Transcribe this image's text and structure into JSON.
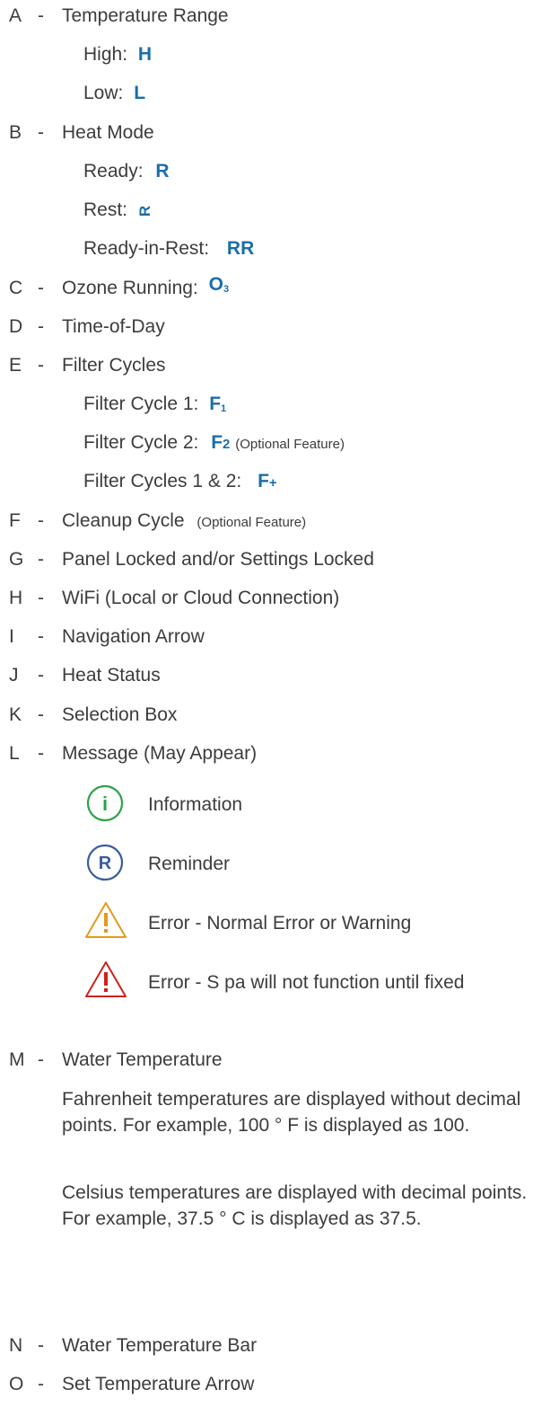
{
  "items": {
    "A": {
      "letter": "A",
      "dash": "-",
      "label": "Temperature Range"
    },
    "A_sub": [
      {
        "text": "High:",
        "sym": "H"
      },
      {
        "text": "Low:",
        "sym": "L"
      }
    ],
    "B": {
      "letter": "B",
      "dash": "-",
      "label": "Heat Mode"
    },
    "B_sub": [
      {
        "text": "Ready:",
        "sym": "R"
      },
      {
        "text": "Rest:",
        "sym": "R"
      },
      {
        "text": "Ready-in-Rest:",
        "sym": "RR"
      }
    ],
    "C": {
      "letter": "C",
      "dash": "-",
      "label": "Ozone Running:",
      "sym": "O",
      "sym_sub": "3"
    },
    "D": {
      "letter": "D",
      "dash": "-",
      "label": "Time-of-Day"
    },
    "E": {
      "letter": "E",
      "dash": "-",
      "label": "Filter Cycles"
    },
    "E_sub": [
      {
        "text": "Filter Cycle 1:",
        "sym": "F",
        "sym_sub": "1",
        "note": ""
      },
      {
        "text": "Filter Cycle 2:",
        "sym": "F",
        "sym_sub": "2",
        "note": "(Optional Feature)"
      },
      {
        "text": "Filter Cycles 1 & 2:",
        "sym": "F",
        "sym_sub": "+",
        "note": ""
      }
    ],
    "F": {
      "letter": "F",
      "dash": "-",
      "label": "Cleanup Cycle",
      "note": "(Optional Feature)"
    },
    "G": {
      "letter": "G",
      "dash": "-",
      "label": "Panel Locked and/or Settings Locked"
    },
    "H": {
      "letter": "H",
      "dash": "-",
      "label": "WiFi (Local or Cloud Connection)"
    },
    "I": {
      "letter": "I",
      "dash": "-",
      "label": "Navigation Arrow"
    },
    "J": {
      "letter": "J",
      "dash": "-",
      "label": "Heat Status"
    },
    "K": {
      "letter": "K",
      "dash": "-",
      "label": "Selection Box"
    },
    "L": {
      "letter": "L",
      "dash": "-",
      "label": "Message  (May Appear)"
    },
    "messages": [
      {
        "icon": "info-icon",
        "glyph": "i",
        "text": "Information",
        "color": "#2aa34a"
      },
      {
        "icon": "reminder-icon",
        "glyph": "R",
        "text": "Reminder",
        "color": "#3a5ba0"
      },
      {
        "icon": "warning-icon",
        "glyph": "!",
        "text": "Error - Normal Error or Warning",
        "color": "#e39a1b"
      },
      {
        "icon": "error-icon",
        "glyph": "!",
        "text": "Error  - S pa will not function until fixed",
        "color": "#d0211b"
      }
    ],
    "M": {
      "letter": "M",
      "dash": "-",
      "label": "Water Temperature"
    },
    "M_paras": [
      "Fahrenheit temperatures are displayed without decimal points. For example, 100 ° F is displayed as  100.",
      "Celsius temperatures are displayed with decimal points. For example, 37.5 ° C is displayed as  37.5."
    ],
    "N": {
      "letter": "N",
      "dash": "-",
      "label": "Water Temperature Bar"
    },
    "O": {
      "letter": "O",
      "dash": "-",
      "label": "Set Temperature Arrow"
    }
  }
}
